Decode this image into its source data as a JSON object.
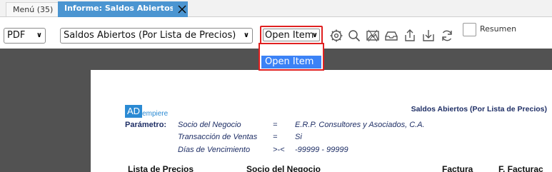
{
  "tabs": {
    "menu": "Menú (35)",
    "active": "Informe: Saldos Abiertos (P..."
  },
  "toolbar": {
    "format": "PDF",
    "report_view": "Saldos Abiertos (Por Lista de Precios)",
    "print_format": "Open Item",
    "summary_label": "Resumen",
    "icons": [
      "gear-icon",
      "search-icon",
      "image-icon",
      "archive-icon",
      "export-icon",
      "download-icon",
      "refresh-icon"
    ]
  },
  "dropdown": {
    "options": [
      "Open Item"
    ],
    "selected": "Open Item"
  },
  "report": {
    "logo_main": "AD",
    "logo_sub": "empiere",
    "title": "Saldos Abiertos (Por Lista de Precios)",
    "param_label": "Parámetro:",
    "params": [
      {
        "name": "Socio del Negocio",
        "op": "=",
        "value": "E.R.P. Consultores y Asociados, C.A."
      },
      {
        "name": "Transacción de Ventas",
        "op": "=",
        "value": "Si"
      },
      {
        "name": "Días de Vencimiento",
        "op": ">-<",
        "value": "-99999 - 99999"
      }
    ],
    "columns": [
      "Lista de Precios",
      "Socio del Negocio",
      "Factura",
      "F. Facturac"
    ]
  },
  "colors": {
    "tab_active": "#4b95d1",
    "highlight": "#e02020",
    "selected_option": "#3b82f6",
    "viewer_bg": "#525252",
    "report_text": "#1f2f66"
  }
}
